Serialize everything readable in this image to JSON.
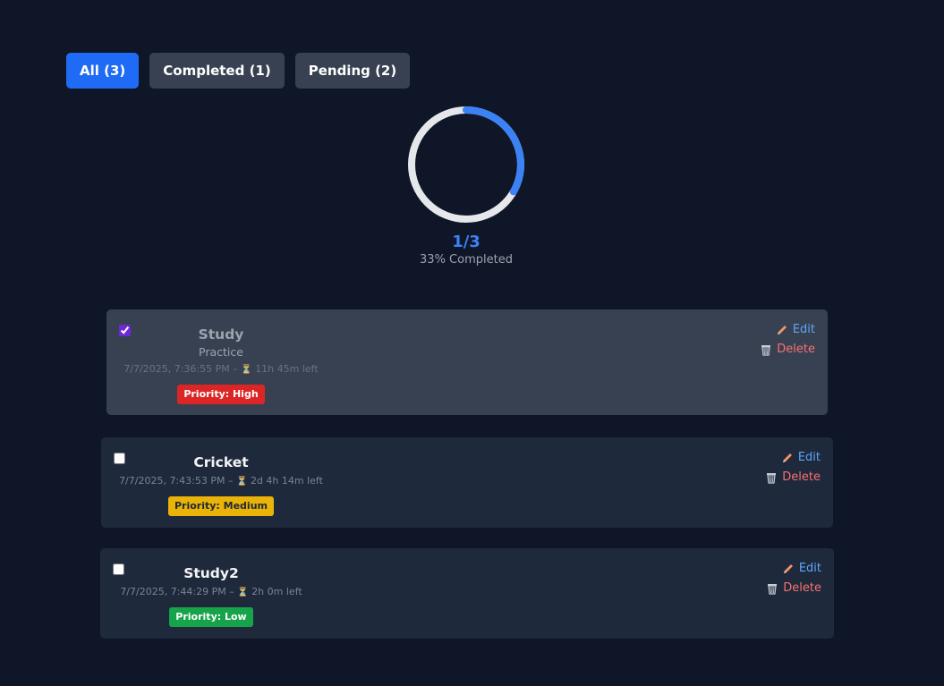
{
  "filters": [
    {
      "label": "All (3)",
      "active": true
    },
    {
      "label": "Completed (1)",
      "active": false
    },
    {
      "label": "Pending (2)",
      "active": false
    }
  ],
  "progress": {
    "completed": 1,
    "total": 3,
    "fraction_text": "1/3",
    "label": "33% Completed",
    "ratio": 0.333,
    "colors": {
      "track": "#e5e7eb",
      "fill": "#3b82f6"
    }
  },
  "tasks": [
    {
      "title": "Study",
      "subtitle": "Practice",
      "datetime": "7/7/2025, 7:36:55 PM –",
      "hourglass": "⏳",
      "remaining": "11h 45m left",
      "priority": "Priority: High",
      "completed": true,
      "edit_label": "Edit",
      "delete_label": "Delete"
    },
    {
      "title": "Cricket",
      "subtitle": "",
      "datetime": "7/7/2025, 7:43:53 PM –",
      "hourglass": "⏳",
      "remaining": "2d 4h 14m left",
      "priority": "Priority: Medium",
      "completed": false,
      "edit_label": "Edit",
      "delete_label": "Delete"
    },
    {
      "title": "Study2",
      "subtitle": "",
      "datetime": "7/7/2025, 7:44:29 PM –",
      "hourglass": "⏳",
      "remaining": "2h 0m left",
      "priority": "Priority: Low",
      "completed": false,
      "edit_label": "Edit",
      "delete_label": "Delete"
    }
  ],
  "icons": {
    "edit": "pencil-icon",
    "delete": "trash-icon",
    "timer": "hourglass-icon"
  },
  "colors": {
    "background": "#0f1627",
    "accent": "#1f6bf5",
    "high": "#dc2626",
    "medium": "#eab308",
    "low": "#16a34a"
  }
}
